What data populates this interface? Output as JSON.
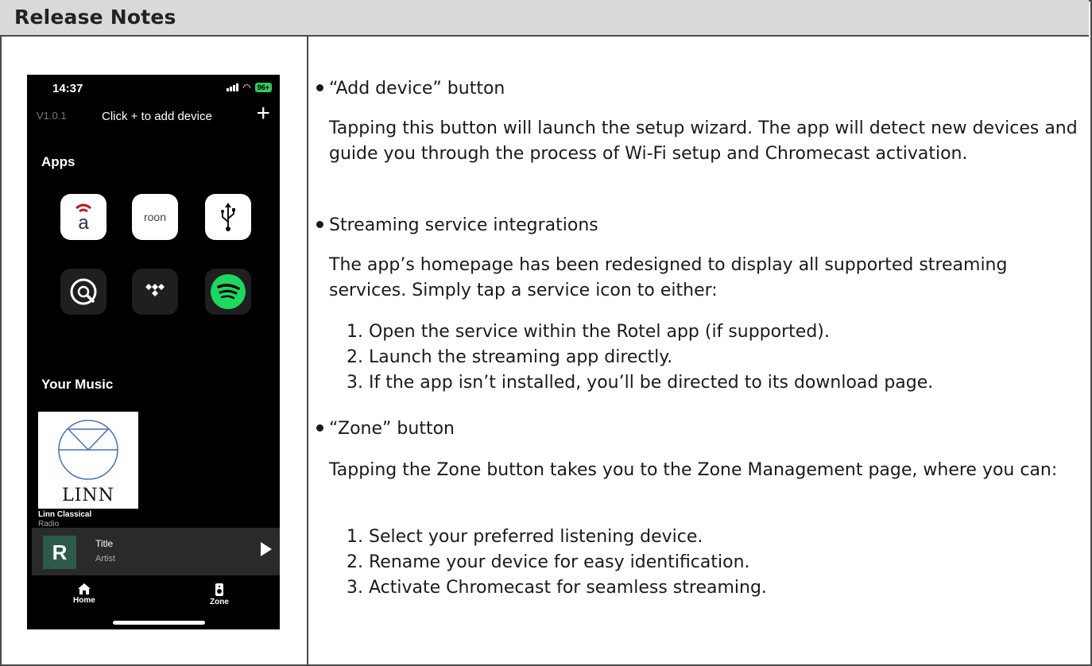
{
  "header": {
    "title": "Release Notes"
  },
  "phone": {
    "status": {
      "time": "14:37",
      "battery": "96+"
    },
    "version": "V1.0.1",
    "topbar_text": "Click + to add device",
    "add_glyph": "+",
    "apps_title": "Apps",
    "apps": [
      {
        "icon": "airable-icon",
        "text": "ā"
      },
      {
        "icon": "roon-icon",
        "text": "roon"
      },
      {
        "icon": "usb-icon",
        "text": ""
      },
      {
        "icon": "qobuz-icon",
        "text": ""
      },
      {
        "icon": "tidal-icon",
        "text": ""
      },
      {
        "icon": "spotify-icon",
        "text": ""
      }
    ],
    "music_title": "Your Music",
    "music_item": {
      "logo_text": "LINN",
      "name": "Linn Classical",
      "subtitle": "Radio"
    },
    "now_playing": {
      "art_letter": "R",
      "title": "Title",
      "artist": "Artist"
    },
    "tabs": [
      {
        "label": "Home",
        "icon": "home-icon"
      },
      {
        "label": "Zone",
        "icon": "speaker-icon"
      }
    ]
  },
  "notes": {
    "section1": {
      "heading": "“Add device” button",
      "para": "Tapping this button will launch the setup wizard. The app will detect new devices and guide you through the process of Wi-Fi setup and Chromecast activation."
    },
    "section2": {
      "heading": "Streaming service integrations",
      "para": "The app’s homepage has been redesigned to display all supported streaming services. Simply tap a service icon to either:",
      "items": [
        "1. Open the service within the Rotel app (if supported).",
        "2. Launch the streaming app directly.",
        "3. If the app isn’t installed, you’ll be directed to its download page."
      ]
    },
    "section3": {
      "heading": "“Zone” button",
      "para": "Tapping the Zone button takes you to the Zone Management page, where you can:",
      "items": [
        "1. Select your preferred listening device.",
        "2. Rename your device for easy identification.",
        "3. Activate Chromecast for seamless streaming."
      ]
    }
  }
}
